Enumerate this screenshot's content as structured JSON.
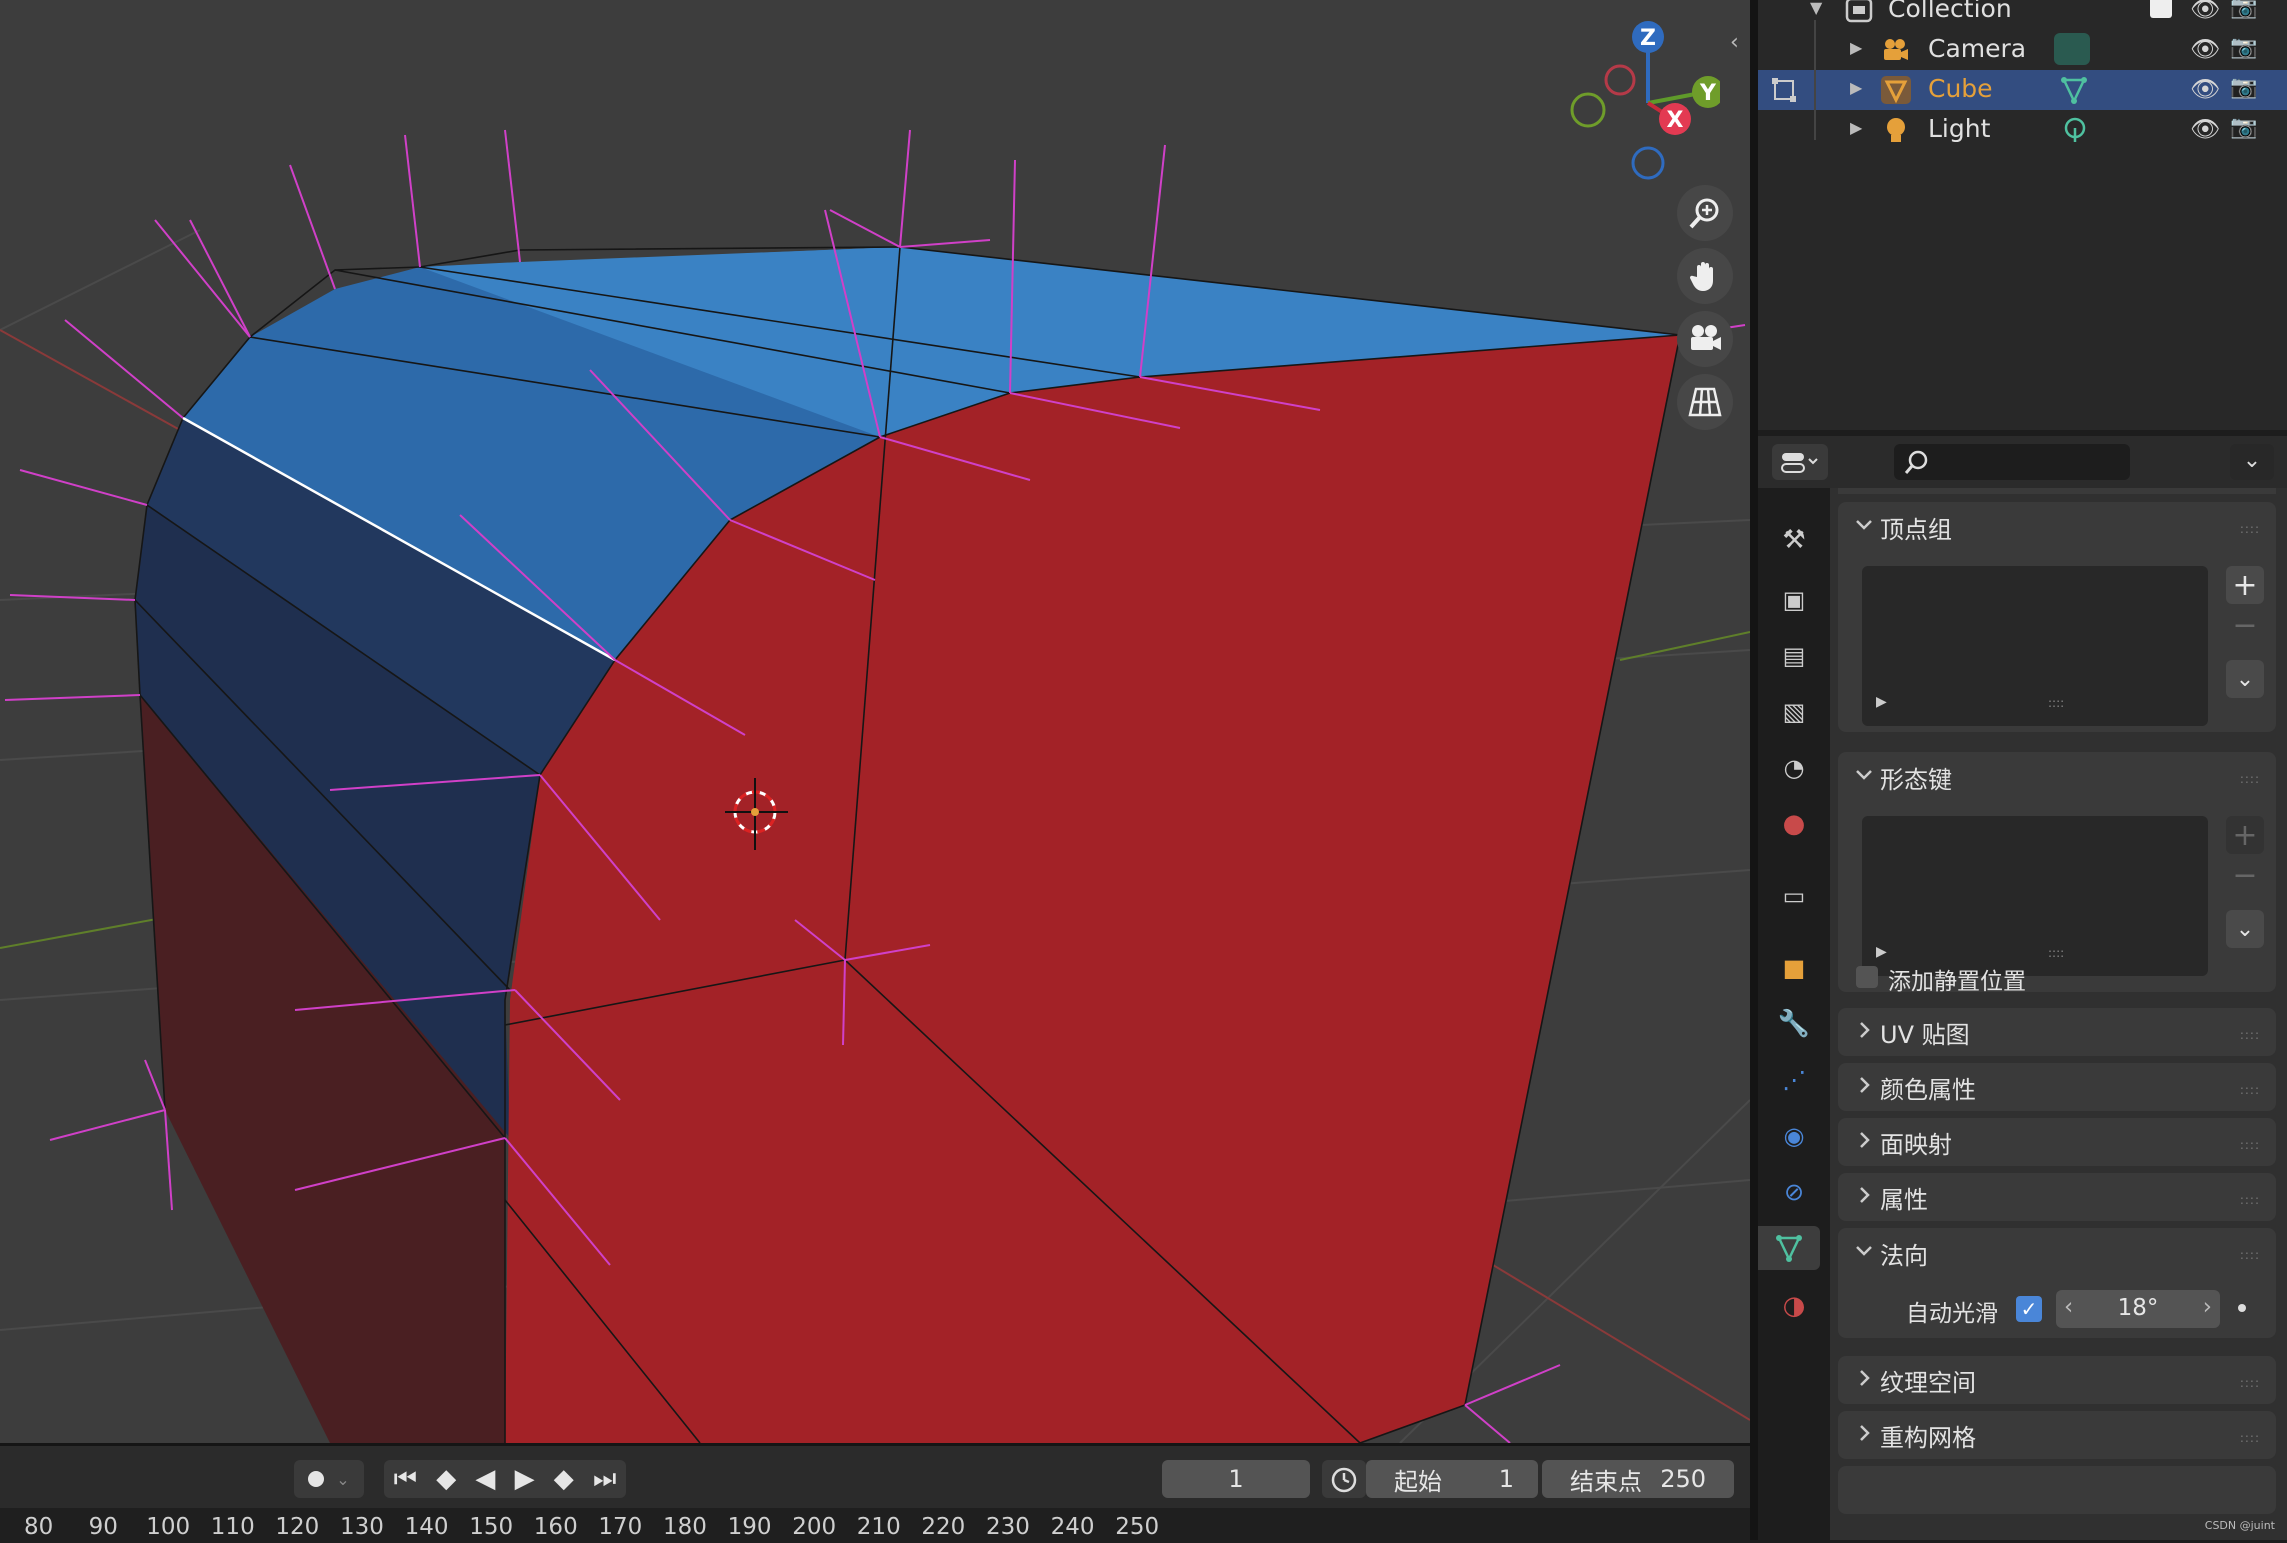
{
  "outliner": {
    "collection_label": "Collection",
    "items": [
      {
        "label": "Camera"
      },
      {
        "label": "Cube"
      },
      {
        "label": "Light"
      }
    ]
  },
  "properties": {
    "search_placeholder": "",
    "panels": {
      "vertex_groups": "顶点组",
      "shape_keys": "形态键",
      "add_rest_position": "添加静置位置",
      "uv_maps": "UV 贴图",
      "color_attributes": "颜色属性",
      "face_maps": "面映射",
      "attributes": "属性",
      "normals": "法向",
      "auto_smooth_label": "自动光滑",
      "auto_smooth_angle": "18°",
      "texture_space": "纹理空间",
      "remesh": "重构网格"
    }
  },
  "gizmo": {
    "z": "Z",
    "y": "Y",
    "x": "X"
  },
  "timeline": {
    "current_frame": "1",
    "start_label": "起始",
    "start_value": "1",
    "end_label": "结束点",
    "end_value": "250",
    "ruler": [
      "80",
      "90",
      "100",
      "110",
      "120",
      "130",
      "140",
      "150",
      "160",
      "170",
      "180",
      "190",
      "200",
      "210",
      "220",
      "230",
      "240",
      "250"
    ]
  },
  "watermark": "CSDN @juint",
  "colors": {
    "selected_row": "#334d80",
    "face_red": "#a32227",
    "face_blue": "#3a82c4",
    "normal_lines": "#d040c8",
    "accent_orange": "#e5a03a",
    "checkbox_blue": "#4a86d8"
  }
}
